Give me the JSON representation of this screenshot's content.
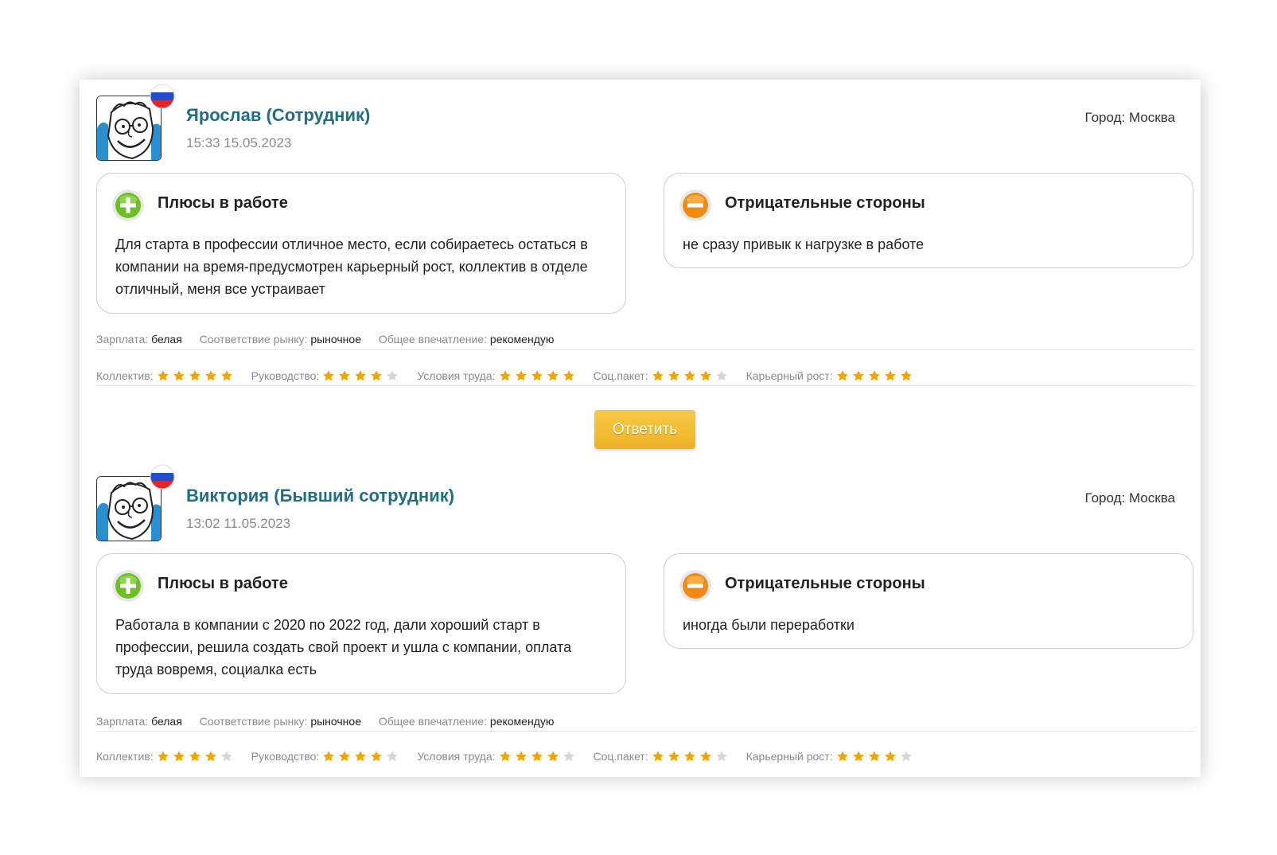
{
  "reviews": [
    {
      "author": "Ярослав (Сотрудник)",
      "date": "15:33 15.05.2023",
      "city": "Город: Москва",
      "pros_title": "Плюсы в работе",
      "pros_text": "Для старта в профессии отличное место, если собираетесь остаться в компании на время-предусмотрен карьерный рост, коллектив в отделе отличный, меня все устраивает",
      "cons_title": "Отрицательные стороны",
      "cons_text": "не сразу привык к нагрузке в работе",
      "salary_label": "Зарплата:",
      "salary_value": "белая",
      "market_label": "Соответствие рынку:",
      "market_value": "рыночное",
      "impression_label": "Общее впечатление:",
      "impression_value": "рекомендую",
      "ratings": [
        {
          "label": "Коллектив:",
          "stars": 5
        },
        {
          "label": "Руководство:",
          "stars": 4
        },
        {
          "label": "Условия труда:",
          "stars": 5
        },
        {
          "label": "Соц.пакет:",
          "stars": 4
        },
        {
          "label": "Карьерный рост:",
          "stars": 5
        }
      ]
    },
    {
      "author": "Виктория (Бывший сотрудник)",
      "date": "13:02 11.05.2023",
      "city": "Город: Москва",
      "pros_title": "Плюсы в работе",
      "pros_text": "Работала в компании с 2020 по 2022 год, дали хороший старт в профессии, решила создать свой проект и ушла с компании, оплата труда вовремя, социалка есть",
      "cons_title": "Отрицательные стороны",
      "cons_text": "иногда были переработки",
      "salary_label": "Зарплата:",
      "salary_value": "белая",
      "market_label": "Соответствие рынку:",
      "market_value": "рыночное",
      "impression_label": "Общее впечатление:",
      "impression_value": "рекомендую",
      "ratings": [
        {
          "label": "Коллектив:",
          "stars": 4
        },
        {
          "label": "Руководство:",
          "stars": 4
        },
        {
          "label": "Условия труда:",
          "stars": 4
        },
        {
          "label": "Соц.пакет:",
          "stars": 4
        },
        {
          "label": "Карьерный рост:",
          "stars": 4
        }
      ]
    }
  ],
  "reply_button": "Ответить",
  "colors": {
    "author": "#1e6f85",
    "star_filled": "#f0a500",
    "star_empty": "#d6d6d6",
    "button": "#f2bb33",
    "plus_icon": "#6cc024",
    "minus_icon": "#f08a10"
  },
  "icons": {
    "avatar": "cartoon-face-avatar",
    "flag": "russia-flag-icon",
    "plus": "plus-circle-icon",
    "minus": "minus-circle-icon",
    "star": "star-icon"
  }
}
